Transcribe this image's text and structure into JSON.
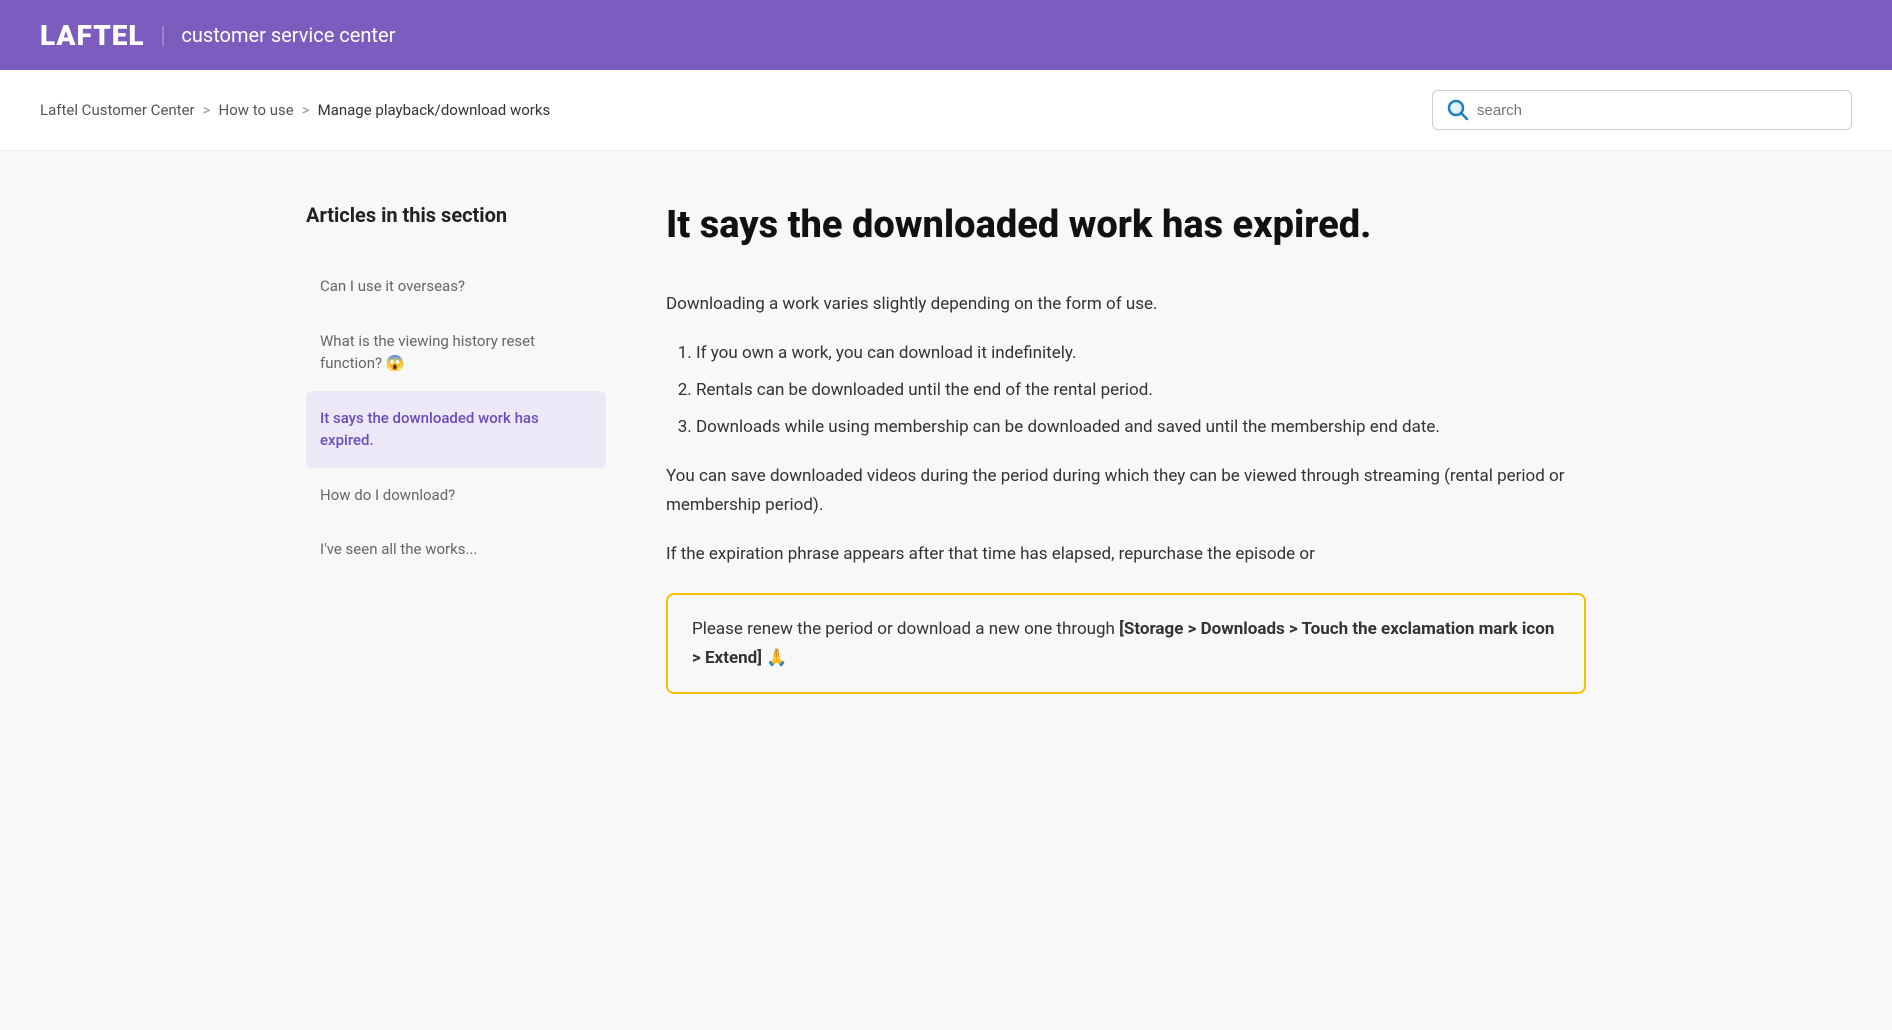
{
  "header": {
    "logo": "LAFTEL",
    "divider": "|",
    "service_name": "customer service center"
  },
  "breadcrumb": {
    "items": [
      {
        "label": "Laftel Customer Center",
        "link": true
      },
      {
        "label": "How to use",
        "link": true
      },
      {
        "label": "Manage playback/download works",
        "link": false
      }
    ],
    "separator": ">"
  },
  "search": {
    "placeholder": "search"
  },
  "sidebar": {
    "section_title": "Articles in this section",
    "items": [
      {
        "label": "Can I use it overseas?",
        "active": false
      },
      {
        "label": "What is the viewing history reset function? 😱",
        "active": false
      },
      {
        "label": "It says the downloaded work has expired.",
        "active": true
      },
      {
        "label": "How do I download?",
        "active": false
      },
      {
        "label": "I've seen all the works...",
        "active": false
      }
    ]
  },
  "article": {
    "title": "It says the downloaded work has expired.",
    "intro": "Downloading a work varies slightly depending on the form of use.",
    "list_items": [
      "If you own a work, you can download it indefinitely.",
      "Rentals can be downloaded until the end of the rental period.",
      "Downloads while using membership can be downloaded and saved until the membership end date."
    ],
    "body_text": "You can save downloaded videos during the period during which they can be viewed through streaming (rental period or membership period).",
    "expiry_text": "If the expiration phrase appears after that time has elapsed, repurchase the episode or",
    "highlight_text_before": "Please renew the period or download a new one through ",
    "highlight_text_bold": "[Storage > Downloads > Touch the exclamation mark icon > Extend]",
    "highlight_emoji": " 🙏"
  }
}
